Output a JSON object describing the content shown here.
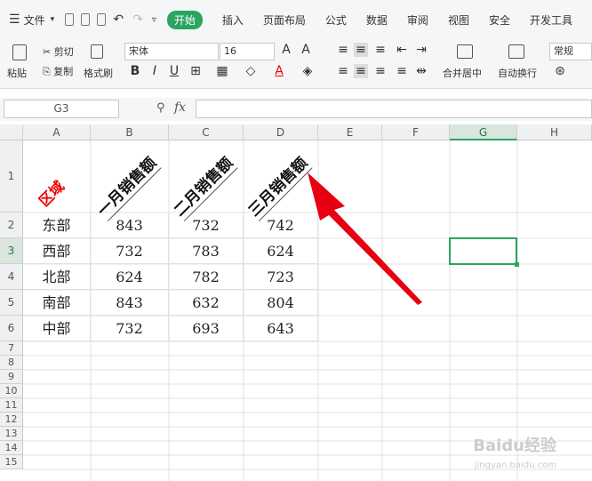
{
  "menubar": {
    "file": "文件",
    "tabs": [
      "开始",
      "插入",
      "页面布局",
      "公式",
      "数据",
      "审阅",
      "视图",
      "安全",
      "开发工具"
    ]
  },
  "ribbon": {
    "paste": "粘贴",
    "cut": "剪切",
    "copy": "复制",
    "format_painter": "格式刷",
    "font_name": "宋体",
    "font_size": "16",
    "merge_center": "合并居中",
    "wrap_text": "自动换行",
    "number_format": "常规"
  },
  "formula_bar": {
    "cell_ref": "G3",
    "fx": "fx",
    "value": ""
  },
  "sheet": {
    "columns": [
      "A",
      "B",
      "C",
      "D",
      "E",
      "F",
      "G",
      "H"
    ],
    "rows": [
      "1",
      "2",
      "3",
      "4",
      "5",
      "6",
      "7",
      "8",
      "9",
      "10",
      "11",
      "12",
      "13",
      "14",
      "15"
    ],
    "headers": [
      "区域",
      "一月销售额",
      "二月销售额",
      "三月销售额"
    ],
    "data": [
      [
        "东部",
        "843",
        "732",
        "742"
      ],
      [
        "西部",
        "732",
        "783",
        "624"
      ],
      [
        "北部",
        "624",
        "782",
        "723"
      ],
      [
        "南部",
        "843",
        "632",
        "804"
      ],
      [
        "中部",
        "732",
        "693",
        "643"
      ]
    ],
    "selected_cell": "G3"
  },
  "colors": {
    "accent": "#2aa55f",
    "arrow": "#e60012",
    "header_red": "#e00000"
  },
  "watermark": {
    "brand": "Baidu经验",
    "url": "jingyan.baidu.com"
  }
}
